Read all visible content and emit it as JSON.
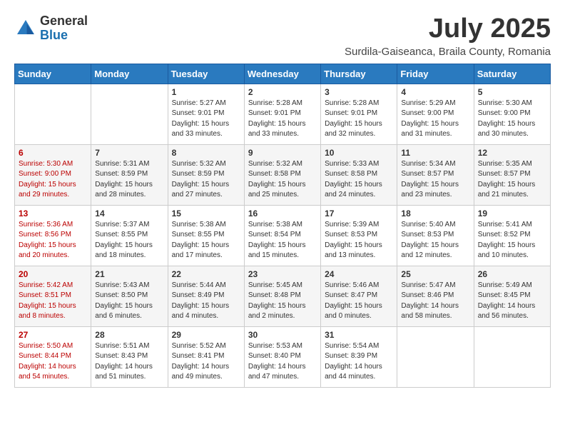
{
  "header": {
    "logo_general": "General",
    "logo_blue": "Blue",
    "month_title": "July 2025",
    "subtitle": "Surdila-Gaiseanca, Braila County, Romania"
  },
  "weekdays": [
    "Sunday",
    "Monday",
    "Tuesday",
    "Wednesday",
    "Thursday",
    "Friday",
    "Saturday"
  ],
  "weeks": [
    [
      {
        "day": "",
        "sunrise": "",
        "sunset": "",
        "daylight": ""
      },
      {
        "day": "",
        "sunrise": "",
        "sunset": "",
        "daylight": ""
      },
      {
        "day": "1",
        "sunrise": "Sunrise: 5:27 AM",
        "sunset": "Sunset: 9:01 PM",
        "daylight": "Daylight: 15 hours and 33 minutes."
      },
      {
        "day": "2",
        "sunrise": "Sunrise: 5:28 AM",
        "sunset": "Sunset: 9:01 PM",
        "daylight": "Daylight: 15 hours and 33 minutes."
      },
      {
        "day": "3",
        "sunrise": "Sunrise: 5:28 AM",
        "sunset": "Sunset: 9:01 PM",
        "daylight": "Daylight: 15 hours and 32 minutes."
      },
      {
        "day": "4",
        "sunrise": "Sunrise: 5:29 AM",
        "sunset": "Sunset: 9:00 PM",
        "daylight": "Daylight: 15 hours and 31 minutes."
      },
      {
        "day": "5",
        "sunrise": "Sunrise: 5:30 AM",
        "sunset": "Sunset: 9:00 PM",
        "daylight": "Daylight: 15 hours and 30 minutes."
      }
    ],
    [
      {
        "day": "6",
        "sunrise": "Sunrise: 5:30 AM",
        "sunset": "Sunset: 9:00 PM",
        "daylight": "Daylight: 15 hours and 29 minutes."
      },
      {
        "day": "7",
        "sunrise": "Sunrise: 5:31 AM",
        "sunset": "Sunset: 8:59 PM",
        "daylight": "Daylight: 15 hours and 28 minutes."
      },
      {
        "day": "8",
        "sunrise": "Sunrise: 5:32 AM",
        "sunset": "Sunset: 8:59 PM",
        "daylight": "Daylight: 15 hours and 27 minutes."
      },
      {
        "day": "9",
        "sunrise": "Sunrise: 5:32 AM",
        "sunset": "Sunset: 8:58 PM",
        "daylight": "Daylight: 15 hours and 25 minutes."
      },
      {
        "day": "10",
        "sunrise": "Sunrise: 5:33 AM",
        "sunset": "Sunset: 8:58 PM",
        "daylight": "Daylight: 15 hours and 24 minutes."
      },
      {
        "day": "11",
        "sunrise": "Sunrise: 5:34 AM",
        "sunset": "Sunset: 8:57 PM",
        "daylight": "Daylight: 15 hours and 23 minutes."
      },
      {
        "day": "12",
        "sunrise": "Sunrise: 5:35 AM",
        "sunset": "Sunset: 8:57 PM",
        "daylight": "Daylight: 15 hours and 21 minutes."
      }
    ],
    [
      {
        "day": "13",
        "sunrise": "Sunrise: 5:36 AM",
        "sunset": "Sunset: 8:56 PM",
        "daylight": "Daylight: 15 hours and 20 minutes."
      },
      {
        "day": "14",
        "sunrise": "Sunrise: 5:37 AM",
        "sunset": "Sunset: 8:55 PM",
        "daylight": "Daylight: 15 hours and 18 minutes."
      },
      {
        "day": "15",
        "sunrise": "Sunrise: 5:38 AM",
        "sunset": "Sunset: 8:55 PM",
        "daylight": "Daylight: 15 hours and 17 minutes."
      },
      {
        "day": "16",
        "sunrise": "Sunrise: 5:38 AM",
        "sunset": "Sunset: 8:54 PM",
        "daylight": "Daylight: 15 hours and 15 minutes."
      },
      {
        "day": "17",
        "sunrise": "Sunrise: 5:39 AM",
        "sunset": "Sunset: 8:53 PM",
        "daylight": "Daylight: 15 hours and 13 minutes."
      },
      {
        "day": "18",
        "sunrise": "Sunrise: 5:40 AM",
        "sunset": "Sunset: 8:53 PM",
        "daylight": "Daylight: 15 hours and 12 minutes."
      },
      {
        "day": "19",
        "sunrise": "Sunrise: 5:41 AM",
        "sunset": "Sunset: 8:52 PM",
        "daylight": "Daylight: 15 hours and 10 minutes."
      }
    ],
    [
      {
        "day": "20",
        "sunrise": "Sunrise: 5:42 AM",
        "sunset": "Sunset: 8:51 PM",
        "daylight": "Daylight: 15 hours and 8 minutes."
      },
      {
        "day": "21",
        "sunrise": "Sunrise: 5:43 AM",
        "sunset": "Sunset: 8:50 PM",
        "daylight": "Daylight: 15 hours and 6 minutes."
      },
      {
        "day": "22",
        "sunrise": "Sunrise: 5:44 AM",
        "sunset": "Sunset: 8:49 PM",
        "daylight": "Daylight: 15 hours and 4 minutes."
      },
      {
        "day": "23",
        "sunrise": "Sunrise: 5:45 AM",
        "sunset": "Sunset: 8:48 PM",
        "daylight": "Daylight: 15 hours and 2 minutes."
      },
      {
        "day": "24",
        "sunrise": "Sunrise: 5:46 AM",
        "sunset": "Sunset: 8:47 PM",
        "daylight": "Daylight: 15 hours and 0 minutes."
      },
      {
        "day": "25",
        "sunrise": "Sunrise: 5:47 AM",
        "sunset": "Sunset: 8:46 PM",
        "daylight": "Daylight: 14 hours and 58 minutes."
      },
      {
        "day": "26",
        "sunrise": "Sunrise: 5:49 AM",
        "sunset": "Sunset: 8:45 PM",
        "daylight": "Daylight: 14 hours and 56 minutes."
      }
    ],
    [
      {
        "day": "27",
        "sunrise": "Sunrise: 5:50 AM",
        "sunset": "Sunset: 8:44 PM",
        "daylight": "Daylight: 14 hours and 54 minutes."
      },
      {
        "day": "28",
        "sunrise": "Sunrise: 5:51 AM",
        "sunset": "Sunset: 8:43 PM",
        "daylight": "Daylight: 14 hours and 51 minutes."
      },
      {
        "day": "29",
        "sunrise": "Sunrise: 5:52 AM",
        "sunset": "Sunset: 8:41 PM",
        "daylight": "Daylight: 14 hours and 49 minutes."
      },
      {
        "day": "30",
        "sunrise": "Sunrise: 5:53 AM",
        "sunset": "Sunset: 8:40 PM",
        "daylight": "Daylight: 14 hours and 47 minutes."
      },
      {
        "day": "31",
        "sunrise": "Sunrise: 5:54 AM",
        "sunset": "Sunset: 8:39 PM",
        "daylight": "Daylight: 14 hours and 44 minutes."
      },
      {
        "day": "",
        "sunrise": "",
        "sunset": "",
        "daylight": ""
      },
      {
        "day": "",
        "sunrise": "",
        "sunset": "",
        "daylight": ""
      }
    ]
  ]
}
